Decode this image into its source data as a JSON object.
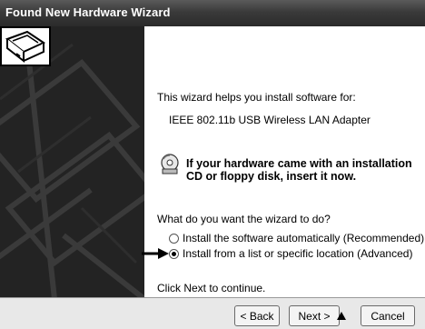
{
  "window": {
    "title": "Found New Hardware Wizard"
  },
  "content": {
    "intro": "This wizard helps you install software for:",
    "device_name": "IEEE 802.11b USB Wireless LAN Adapter",
    "cd_notice": "If your hardware came with an installation CD or floppy disk, insert it now.",
    "question": "What do you want the wizard to do?",
    "options": [
      {
        "label": "Install the software automatically (Recommended)",
        "selected": false
      },
      {
        "label": "Install from a list or specific location (Advanced)",
        "selected": true
      }
    ],
    "footer_hint": "Click Next to continue."
  },
  "buttons": {
    "back": "< Back",
    "next": "Next >",
    "cancel": "Cancel"
  },
  "icons": {
    "hardware": "hardware-wizard-icon",
    "cd": "cd-icon",
    "arrow": "pointer-arrow-icon"
  }
}
